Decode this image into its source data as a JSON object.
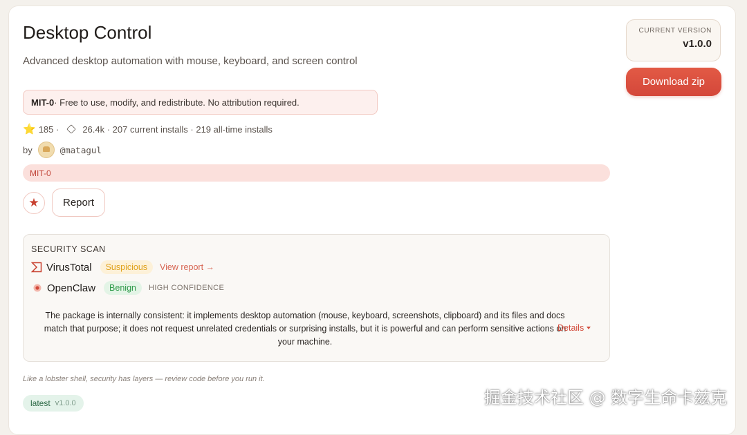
{
  "page": {
    "title": "Desktop Control",
    "subtitle": "Advanced desktop automation with mouse, keyboard, and screen control"
  },
  "license": {
    "name": "MIT-0",
    "description": " · Free to use, modify, and redistribute. No attribution required.",
    "pill": "MIT-0"
  },
  "stats": {
    "stars": "185 ·",
    "downloads": "26.4k · 207 current installs · 219 all-time installs"
  },
  "author": {
    "by_label": "by",
    "handle": "@matagul"
  },
  "actions": {
    "star_icon": "★",
    "report_label": "Report"
  },
  "security_scan": {
    "title": "SECURITY SCAN",
    "virustotal": {
      "name": "VirusTotal",
      "status": "Suspicious",
      "link": "View report →",
      "status_color": "#e0a11a"
    },
    "openclaw": {
      "name": "OpenClaw",
      "status": "Benign",
      "confidence": "HIGH CONFIDENCE",
      "status_color": "#2f9a4a"
    },
    "description": "The package is internally consistent: it implements desktop automation (mouse, keyboard, screenshots, clipboard) and its files and docs match that purpose; it does not request unrelated credentials or surprising installs, but it is powerful and can perform sensitive actions on your machine.",
    "details_label": "Details"
  },
  "footnote": "Like a lobster shell, security has layers — review code before you run it.",
  "tag": {
    "label": "latest",
    "version": "v1.0.0"
  },
  "sidebar": {
    "version_label": "CURRENT VERSION",
    "version_value": "v1.0.0",
    "download_label": "Download zip",
    "accent_color": "#d94c3c"
  },
  "watermark": "掘金技术社区 @ 数字生命卡兹克"
}
